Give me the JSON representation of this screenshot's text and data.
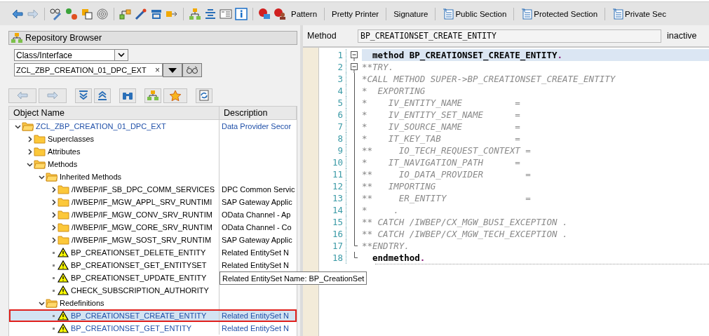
{
  "toolbar": {
    "text_buttons": [
      {
        "label": "Pattern",
        "icon": false
      },
      {
        "label": "Pretty Printer",
        "icon": false
      },
      {
        "label": "Signature",
        "icon": false
      },
      {
        "label": "Public Section",
        "icon": true
      },
      {
        "label": "Protected Section",
        "icon": true
      },
      {
        "label": "Private Sec",
        "icon": true
      }
    ]
  },
  "repository_browser": {
    "title": "Repository Browser",
    "object_type": "Class/Interface",
    "object_name": "ZCL_ZBP_CREATION_01_DPC_EXT",
    "clear": "×",
    "columns": [
      "Object Name",
      "Description"
    ],
    "tree": [
      {
        "kind": "folder",
        "label": "ZCL_ZBP_CREATION_01_DPC_EXT",
        "description": "Data Provider Secor",
        "link": true,
        "selected": false,
        "expanded": true,
        "children": [
          {
            "kind": "folder",
            "label": "Superclasses",
            "link": false,
            "selected": false,
            "expanded": false
          },
          {
            "kind": "folder",
            "label": "Attributes",
            "link": false,
            "selected": false,
            "expanded": false
          },
          {
            "kind": "folder",
            "label": "Methods",
            "link": false,
            "selected": false,
            "expanded": true,
            "children": [
              {
                "kind": "folder",
                "label": "Inherited Methods",
                "link": false,
                "selected": false,
                "expanded": true,
                "children": [
                  {
                    "kind": "folder",
                    "label": "/IWBEP/IF_SB_DPC_COMM_SERVICES",
                    "description": "DPC Common Servic",
                    "link": false,
                    "selected": false,
                    "expanded": false
                  },
                  {
                    "kind": "folder",
                    "label": "/IWBEP/IF_MGW_APPL_SRV_RUNTIMI",
                    "description": "SAP Gateway Applic",
                    "link": false,
                    "selected": false,
                    "expanded": false
                  },
                  {
                    "kind": "folder",
                    "label": "/IWBEP/IF_MGW_CONV_SRV_RUNTIM",
                    "description": "OData Channel - Ap",
                    "link": false,
                    "selected": false,
                    "expanded": false
                  },
                  {
                    "kind": "folder",
                    "label": "/IWBEP/IF_MGW_CORE_SRV_RUNTIM",
                    "description": "OData Channel - Co",
                    "link": false,
                    "selected": false,
                    "expanded": false
                  },
                  {
                    "kind": "folder",
                    "label": "/IWBEP/IF_MGW_SOST_SRV_RUNTIM",
                    "description": "SAP Gateway Applic",
                    "link": false,
                    "selected": false,
                    "expanded": false
                  },
                  {
                    "kind": "warning",
                    "label": "BP_CREATIONSET_DELETE_ENTITY",
                    "description": "Related EntitySet N",
                    "link": false,
                    "selected": false
                  },
                  {
                    "kind": "warning",
                    "label": "BP_CREATIONSET_GET_ENTITYSET",
                    "description": "Related EntitySet N",
                    "link": false,
                    "selected": false
                  },
                  {
                    "kind": "warning",
                    "label": "BP_CREATIONSET_UPDATE_ENTITY",
                    "tooltip": "Related EntitySet Name: BP_CreationSet",
                    "link": false,
                    "selected": false
                  },
                  {
                    "kind": "warning",
                    "label": "CHECK_SUBSCRIPTION_AUTHORITY",
                    "link": false,
                    "selected": false
                  }
                ]
              },
              {
                "kind": "folder",
                "label": "Redefinitions",
                "link": false,
                "selected": false,
                "expanded": true,
                "children": [
                  {
                    "kind": "warning",
                    "label": "BP_CREATIONSET_CREATE_ENTITY",
                    "description": "Related EntitySet N",
                    "link": true,
                    "selected": true
                  },
                  {
                    "kind": "warning",
                    "label": "BP_CREATIONSET_GET_ENTITY",
                    "description": "Related EntitySet N",
                    "link": true,
                    "selected": false
                  }
                ]
              }
            ]
          }
        ]
      }
    ]
  },
  "editor": {
    "label": "Method",
    "method": "BP_CREATIONSET_CREATE_ENTITY",
    "status": "inactive",
    "lines": [
      {
        "number": "1",
        "kind": "code",
        "text": "  method BP_CREATIONSET_CREATE_ENTITY",
        "end": ".",
        "current": true,
        "foldable": true,
        "block_end": false
      },
      {
        "number": "2",
        "kind": "comment",
        "text": "**TRY.",
        "current": false,
        "foldable": true,
        "block_end": false
      },
      {
        "number": "3",
        "kind": "comment",
        "text": "*CALL METHOD SUPER->BP_CREATIONSET_CREATE_ENTITY",
        "current": false,
        "foldable": false,
        "block_end": false
      },
      {
        "number": "4",
        "kind": "comment",
        "text": "*  EXPORTING",
        "current": false,
        "foldable": false,
        "block_end": false
      },
      {
        "number": "5",
        "kind": "comment",
        "text": "*    IV_ENTITY_NAME          =",
        "current": false,
        "foldable": false,
        "block_end": false
      },
      {
        "number": "6",
        "kind": "comment",
        "text": "*    IV_ENTITY_SET_NAME      =",
        "current": false,
        "foldable": false,
        "block_end": false
      },
      {
        "number": "7",
        "kind": "comment",
        "text": "*    IV_SOURCE_NAME          =",
        "current": false,
        "foldable": false,
        "block_end": false
      },
      {
        "number": "8",
        "kind": "comment",
        "text": "*    IT_KEY_TAB              =",
        "current": false,
        "foldable": false,
        "block_end": false
      },
      {
        "number": "9",
        "kind": "comment",
        "text": "**     IO_TECH_REQUEST_CONTEXT =",
        "current": false,
        "foldable": false,
        "block_end": false
      },
      {
        "number": "10",
        "kind": "comment",
        "text": "*    IT_NAVIGATION_PATH      =",
        "current": false,
        "foldable": false,
        "block_end": false
      },
      {
        "number": "11",
        "kind": "comment",
        "text": "**     IO_DATA_PROVIDER        =",
        "current": false,
        "foldable": false,
        "block_end": false
      },
      {
        "number": "12",
        "kind": "comment",
        "text": "**   IMPORTING",
        "current": false,
        "foldable": false,
        "block_end": false
      },
      {
        "number": "13",
        "kind": "comment",
        "text": "**     ER_ENTITY               =",
        "current": false,
        "foldable": false,
        "block_end": false
      },
      {
        "number": "14",
        "kind": "comment",
        "text": "*     .",
        "current": false,
        "foldable": false,
        "block_end": false
      },
      {
        "number": "15",
        "kind": "comment",
        "text": "** CATCH /IWBEP/CX_MGW_BUSI_EXCEPTION .",
        "current": false,
        "foldable": false,
        "block_end": false
      },
      {
        "number": "16",
        "kind": "comment",
        "text": "** CATCH /IWBEP/CX_MGW_TECH_EXCEPTION .",
        "current": false,
        "foldable": false,
        "block_end": false
      },
      {
        "number": "17",
        "kind": "comment",
        "text": "**ENDTRY.",
        "current": false,
        "foldable": false,
        "block_end": true
      },
      {
        "number": "18",
        "kind": "code",
        "text": "  endmethod",
        "end": ".",
        "current": false,
        "foldable": false,
        "block_end": true
      }
    ]
  }
}
